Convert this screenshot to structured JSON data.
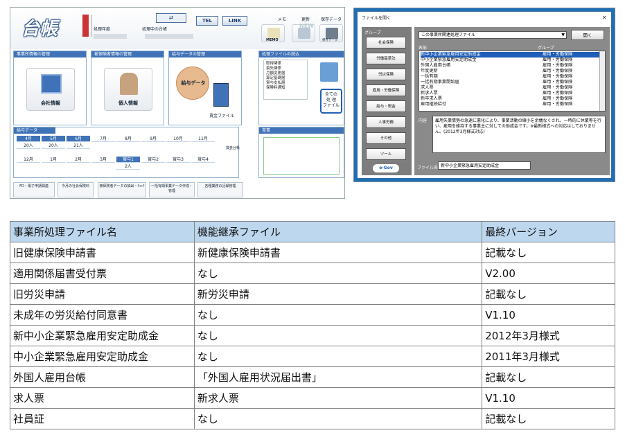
{
  "app": {
    "logo": "台帳",
    "fiscal_label": "処理年度",
    "current_label": "処理中の台帳",
    "tel_button": "TEL",
    "link_button": "LINK",
    "memo_label": "メモ",
    "memo_icon_text": "MEMO",
    "new_label": "更新",
    "new_icon_text": "NEW",
    "save_label": "保存データ",
    "save_icon_text": "保存データ",
    "panels": {
      "office": {
        "title": "事業所情報の管理",
        "button": "会社情報"
      },
      "insured": {
        "title": "被保険者情報の管理",
        "button": "個人情報"
      },
      "salary": {
        "title": "給与データの管理",
        "button": "給与データ",
        "sub": "賃金ファイル"
      },
      "files": {
        "title": "処理ファイルの読込",
        "list": [
          "取得関係",
          "喪失関係",
          "月額変更届",
          "算定基礎届",
          "賞与支払届",
          "保険料通知"
        ],
        "all_button": [
          "全ての",
          "処 理",
          "ファイル"
        ]
      }
    },
    "salary_table": {
      "title": "給与データ",
      "row1": [
        "4月",
        "5月",
        "6月",
        "7月",
        "8月",
        "9月",
        "10月",
        "11月"
      ],
      "row1_counts": [
        "20人",
        "20人",
        "21人"
      ],
      "row2": [
        "12月",
        "1月",
        "2月",
        "3月",
        "賞与1",
        "賞与2",
        "賞与3",
        "賞与4"
      ],
      "row2_counts": [
        "2人"
      ],
      "side": "賞金台帳"
    },
    "memo_panel": {
      "title": "覚書"
    },
    "footer_buttons": [
      "FD・電子申請関連",
      "今月の社会保険料",
      "被保険者データの抽出・ﾁｪｯｸ",
      "一括有期事業データ作成・管理",
      "各種業務の記録管理"
    ]
  },
  "dialog": {
    "title": "ファイルを開く",
    "close": "×",
    "group_header": "グループ",
    "groups": [
      "社会保険",
      "労働基準法",
      "労災保険",
      "雇用・労働保険",
      "給与・税金",
      "人事労務",
      "その他",
      "ツール"
    ],
    "egov": "e-Gov",
    "dropdown_value": "この事業所関連処理ファイル",
    "open_button": "開く",
    "col_name": "名前",
    "col_group": "グループ",
    "files": [
      {
        "name": "新中小企業緊急雇用安定助成金",
        "group": "雇用・労働保険",
        "selected": true
      },
      {
        "name": "中小企業緊急雇用安定助成金",
        "group": "雇用・労働保険",
        "selected": false
      },
      {
        "name": "外国人雇用台帳",
        "group": "雇用・労働保険",
        "selected": false
      },
      {
        "name": "年度更新",
        "group": "雇用・労働保険",
        "selected": false
      },
      {
        "name": "一括有期",
        "group": "雇用・労働保険",
        "selected": false
      },
      {
        "name": "一括有期事業開始届",
        "group": "雇用・労働保険",
        "selected": false
      },
      {
        "name": "求人票",
        "group": "雇用・労働保険",
        "selected": false
      },
      {
        "name": "新求人票",
        "group": "雇用・労働保険",
        "selected": false
      },
      {
        "name": "新卒求人票",
        "group": "雇用・労働保険",
        "selected": false
      },
      {
        "name": "雇用継続給付",
        "group": "雇用・労働保険",
        "selected": false
      }
    ],
    "content_label": "内容",
    "content_text": "雇用失業情勢の急速に悪化により、事業活動の縮小を余儀なくされ、一時的に休業等を行い、雇用を維持する事業主に対しての助成金です。※最新様式への対応はしておりません。(2012年3月様式対応)",
    "filename_label": "ファイル名",
    "filename_value": "新中小企業緊急雇用安定助成金"
  },
  "table": {
    "headers": [
      "事業所処理ファイル名",
      "機能継承ファイル",
      "最終バージョン"
    ],
    "rows": [
      [
        "旧健康保険申請書",
        "新健康保険申請書",
        "記載なし"
      ],
      [
        "適用関係届書受付票",
        "なし",
        "V2.00"
      ],
      [
        "旧労災申請",
        "新労災申請",
        "記載なし"
      ],
      [
        "未成年の労災給付同意書",
        "なし",
        "V1.10"
      ],
      [
        "新中小企業緊急雇用安定助成金",
        "なし",
        "2012年3月様式"
      ],
      [
        "中小企業緊急雇用安定助成金",
        "なし",
        "2011年3月様式"
      ],
      [
        "外国人雇用台帳",
        "「外国人雇用状況届出書」",
        "記載なし"
      ],
      [
        "求人票",
        "新求人票",
        "V1.10"
      ],
      [
        "社員証",
        "なし",
        "記載なし"
      ]
    ]
  },
  "colors": {
    "accent": "#3f72b7",
    "dialog_frame": "#1f6fb4",
    "header_fill": "#bdd7ee",
    "selection": "#1e5db8"
  }
}
